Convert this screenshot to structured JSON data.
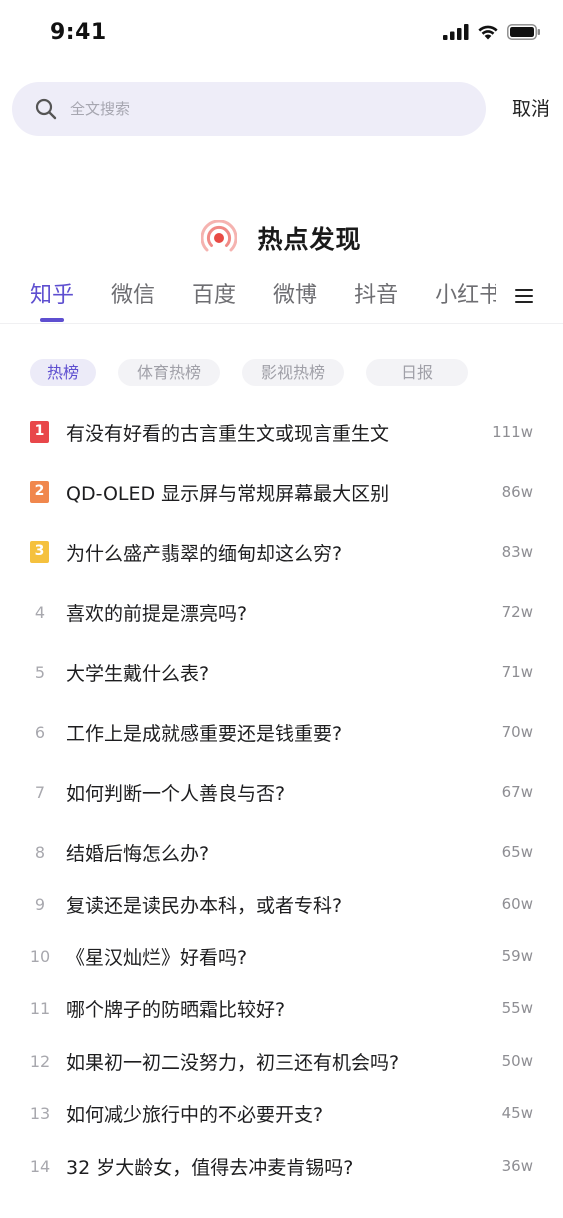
{
  "status_bar": {
    "time": "9:41"
  },
  "search": {
    "placeholder": "全文搜索",
    "cancel_label": "取消"
  },
  "section": {
    "title": "热点发现"
  },
  "tabs": [
    "知乎",
    "微信",
    "百度",
    "微博",
    "抖音",
    "小红书"
  ],
  "chips": [
    "热榜",
    "体育热榜",
    "影视热榜",
    "日报"
  ],
  "colors": {
    "accent": "#5e4fd0",
    "rank1": "#e8474a",
    "rank2": "#f0874d",
    "rank3": "#f5c13e",
    "hot_icon": "#e84b45"
  },
  "hot_list": [
    {
      "rank": "1",
      "title": "有没有好看的古言重生文或现言重生文",
      "heat": "111w"
    },
    {
      "rank": "2",
      "title": "QD-OLED 显示屏与常规屏幕最大区别",
      "heat": "86w"
    },
    {
      "rank": "3",
      "title": "为什么盛产翡翠的缅甸却这么穷?",
      "heat": "83w"
    },
    {
      "rank": "4",
      "title": "喜欢的前提是漂亮吗?",
      "heat": "72w"
    },
    {
      "rank": "5",
      "title": "大学生戴什么表?",
      "heat": "71w"
    },
    {
      "rank": "6",
      "title": "工作上是成就感重要还是钱重要?",
      "heat": "70w"
    },
    {
      "rank": "7",
      "title": "如何判断一个人善良与否?",
      "heat": "67w"
    },
    {
      "rank": "8",
      "title": "结婚后悔怎么办?",
      "heat": "65w"
    },
    {
      "rank": "9",
      "title": "复读还是读民办本科，或者专科?",
      "heat": "60w"
    },
    {
      "rank": "10",
      "title": "《星汉灿烂》好看吗?",
      "heat": "59w"
    },
    {
      "rank": "11",
      "title": "哪个牌子的防晒霜比较好?",
      "heat": "55w"
    },
    {
      "rank": "12",
      "title": "如果初一初二没努力，初三还有机会吗?",
      "heat": "50w"
    },
    {
      "rank": "13",
      "title": "如何减少旅行中的不必要开支?",
      "heat": "45w"
    },
    {
      "rank": "14",
      "title": "32 岁大龄女，值得去冲麦肯锡吗?",
      "heat": "36w"
    }
  ]
}
